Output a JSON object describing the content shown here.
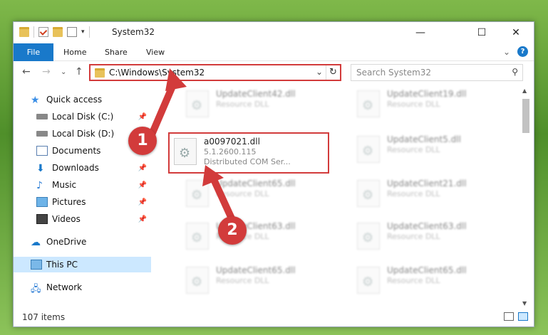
{
  "window": {
    "title": "System32",
    "minimize": "—",
    "maximize": "☐",
    "close": "✕"
  },
  "ribbon": {
    "tabs": [
      "File",
      "Home",
      "Share",
      "View"
    ],
    "expand": "⌄",
    "help": "?"
  },
  "nav": {
    "back": "←",
    "forward": "→",
    "recent": "⌄",
    "up": "↑",
    "address": "C:\\Windows\\System32",
    "search_placeholder": "Search System32"
  },
  "sidebar": {
    "items": [
      {
        "label": "Quick access"
      },
      {
        "label": "Local Disk (C:)"
      },
      {
        "label": "Local Disk (D:)"
      },
      {
        "label": "Documents"
      },
      {
        "label": "Downloads"
      },
      {
        "label": "Music"
      },
      {
        "label": "Pictures"
      },
      {
        "label": "Videos"
      },
      {
        "label": "OneDrive"
      },
      {
        "label": "This PC"
      },
      {
        "label": "Network"
      }
    ]
  },
  "files": [
    {
      "name": "UpdateClient42.dll",
      "desc": "Resource DLL"
    },
    {
      "name": "UpdateClient19.dll",
      "desc": "Resource DLL"
    },
    {
      "name": "UpdateClient5.dll",
      "desc": "Resource DLL"
    },
    {
      "name": "UpdateClient65.dll",
      "desc": "Resource DLL"
    },
    {
      "name": "UpdateClient21.dll",
      "desc": "Resource DLL"
    },
    {
      "name": "UpdateClient63.dll",
      "desc": "Resource DLL"
    },
    {
      "name": "UpdateClient63.dll",
      "desc": "Resource DLL"
    },
    {
      "name": "UpdateClient65.dll",
      "desc": "Resource DLL"
    },
    {
      "name": "UpdateClient65.dll",
      "desc": "Resource DLL"
    }
  ],
  "highlighted_file": {
    "name": "a0097021.dll",
    "version": "5.1.2600.115",
    "desc": "Distributed COM Ser..."
  },
  "status": {
    "count": "107 items"
  },
  "callouts": [
    "1",
    "2"
  ],
  "colors": {
    "accent": "#1979ca",
    "highlight": "#d23b3b"
  }
}
